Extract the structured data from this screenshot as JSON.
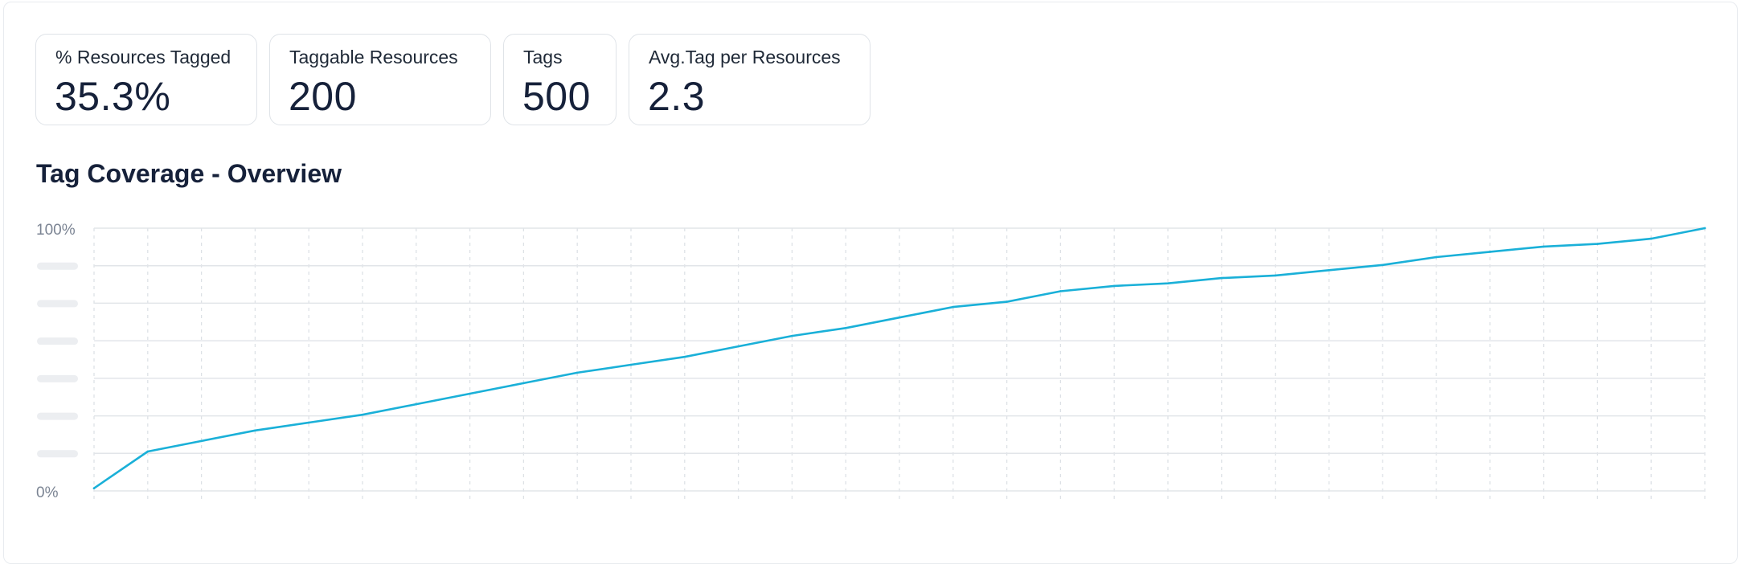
{
  "stats": [
    {
      "label": "% Resources Tagged",
      "value": "35.3%"
    },
    {
      "label": "Taggable Resources",
      "value": "200"
    },
    {
      "label": "Tags",
      "value": "500"
    },
    {
      "label": "Avg.Tag per Resources",
      "value": "2.3"
    }
  ],
  "section": {
    "title": "Tag Coverage - Overview"
  },
  "chart_data": {
    "type": "line",
    "title": "Tag Coverage - Overview",
    "xlabel": "",
    "ylabel": "",
    "ylim": [
      0,
      100
    ],
    "y_tick_labels": [
      "0%",
      "100%"
    ],
    "grid": true,
    "line_color": "#1ab0d8",
    "x": [
      0,
      1,
      2,
      3,
      4,
      5,
      6,
      7,
      8,
      9,
      10,
      11,
      12,
      13,
      14,
      15,
      16,
      17,
      18,
      19,
      20,
      21,
      22,
      23,
      24,
      25,
      26,
      27,
      28,
      29,
      30
    ],
    "series": [
      {
        "values": [
          1,
          15,
          19,
          23,
          26,
          29,
          33,
          37,
          41,
          45,
          48,
          51,
          55,
          59,
          62,
          66,
          70,
          72,
          76,
          78,
          79,
          81,
          82,
          84,
          86,
          89,
          91,
          93,
          94,
          96,
          100
        ]
      }
    ]
  }
}
